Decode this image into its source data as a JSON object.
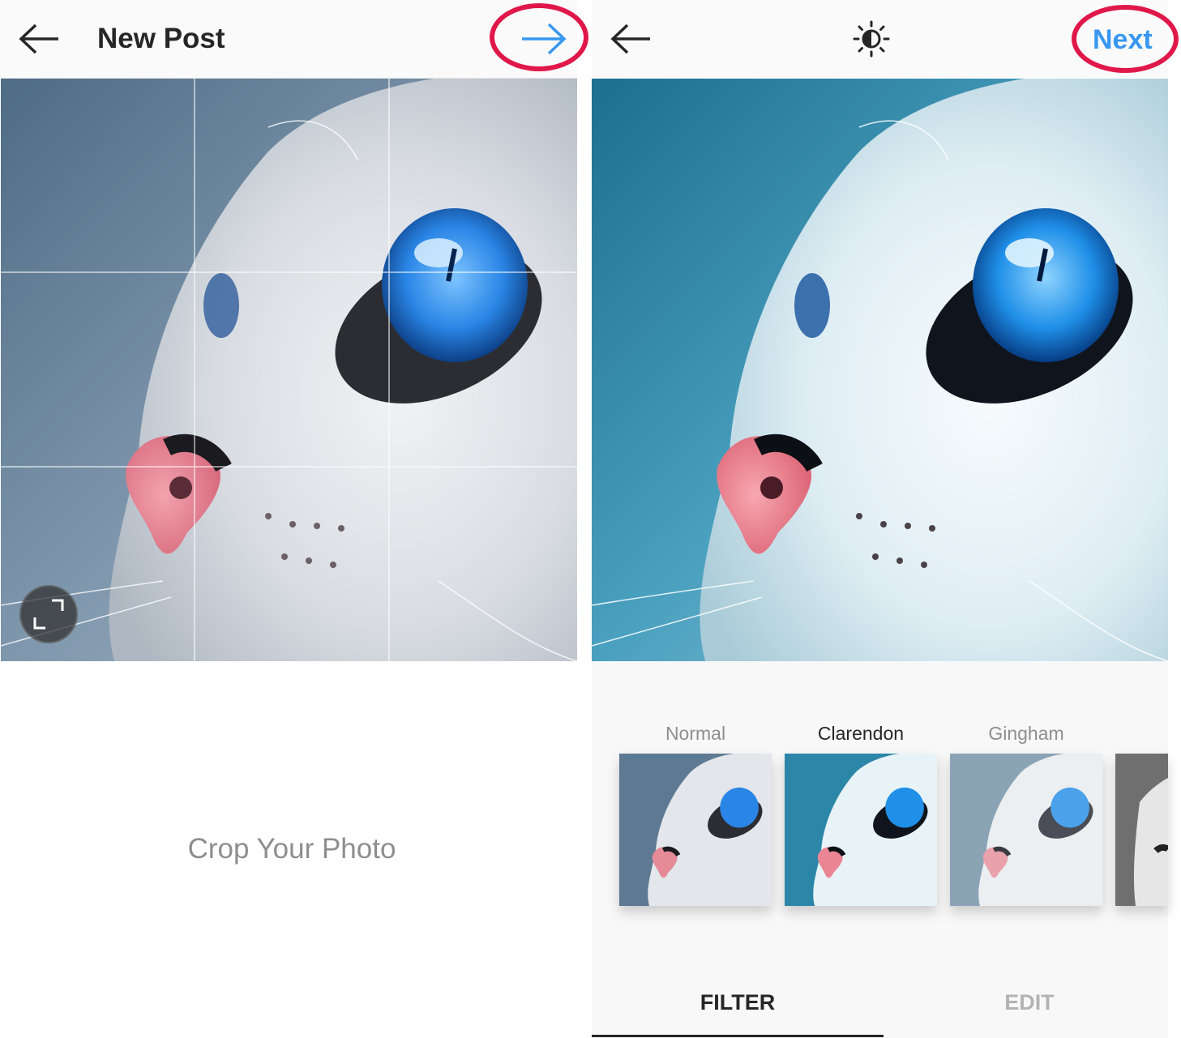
{
  "crop_screen": {
    "title": "New Post",
    "back_icon": "back-arrow-icon",
    "forward_icon": "forward-arrow-icon",
    "expand_icon": "expand-icon",
    "caption": "Crop Your Photo",
    "highlight_color": "#e0184a",
    "accent_color": "#3897f0"
  },
  "filter_screen": {
    "back_icon": "back-arrow-icon",
    "brightness_icon": "lux-brightness-icon",
    "next_label": "Next",
    "filters": [
      {
        "name": "Normal",
        "active": false
      },
      {
        "name": "Clarendon",
        "active": true
      },
      {
        "name": "Gingham",
        "active": false
      },
      {
        "name": "",
        "active": false
      }
    ],
    "tabs": [
      {
        "label": "FILTER",
        "active": true
      },
      {
        "label": "EDIT",
        "active": false
      }
    ]
  }
}
